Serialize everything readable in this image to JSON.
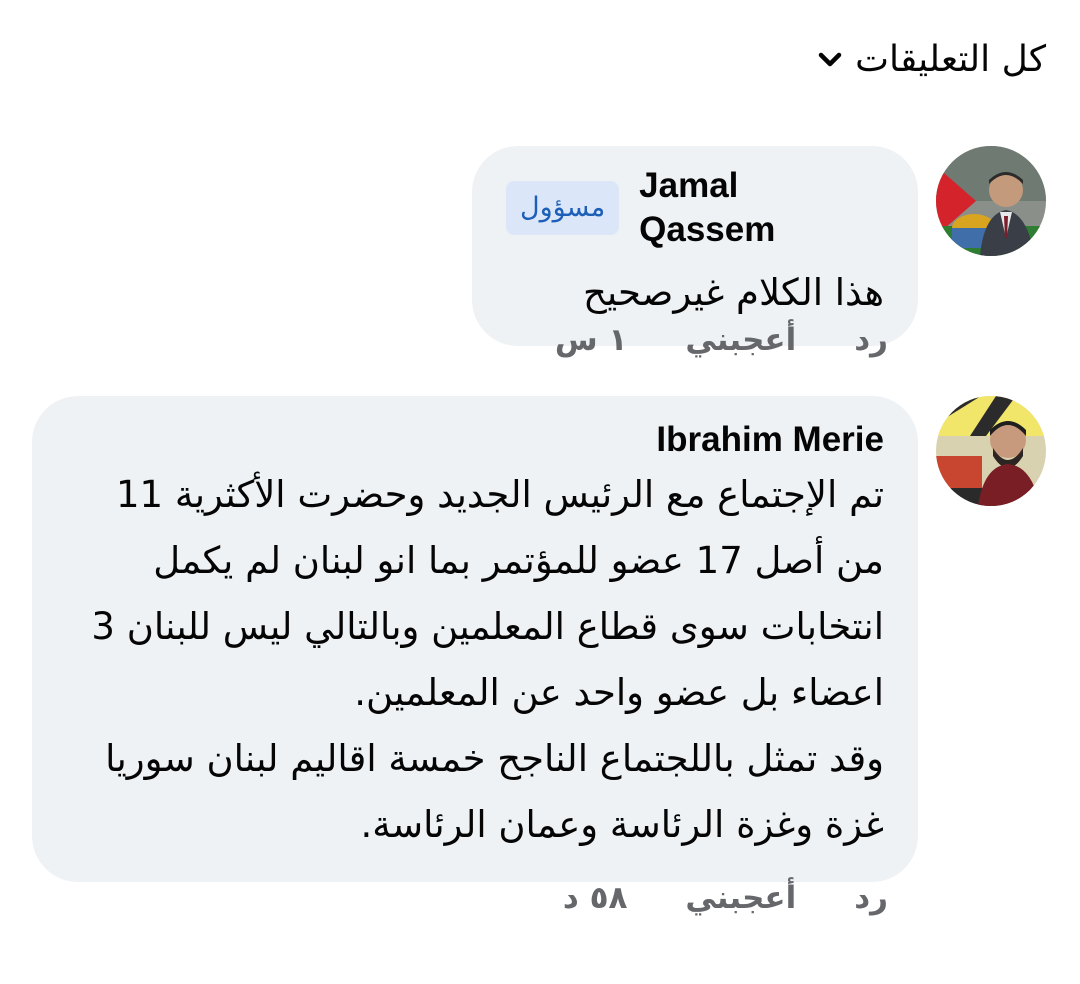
{
  "filter": {
    "label": "كل التعليقات",
    "icon": "chevron-down-icon"
  },
  "comments": [
    {
      "author": "Jamal Qassem",
      "badge": "مسؤول",
      "text": "هذا الكلام غيرصحيح",
      "time": "١ س",
      "like_label": "أعجبني",
      "reply_label": "رد"
    },
    {
      "author": "Ibrahim Merie",
      "text": "تم الإجتماع مع الرئيس الجديد وحضرت الأكثرية 11\nمن أصل 17 عضو للمؤتمر بما انو لبنان لم يكمل\nانتخابات سوى قطاع المعلمين وبالتالي ليس للبنان 3\nاعضاء بل عضو واحد عن المعلمين.\nوقد تمثل باللجتماع الناجح خمسة اقاليم لبنان سوريا\nغزة وغزة الرئاسة وعمان الرئاسة.",
      "time": "٥٨ د",
      "like_label": "أعجبني",
      "reply_label": "رد"
    }
  ],
  "colors": {
    "bubble": "#eff2f5",
    "badge_bg": "#dbe7f8",
    "badge_text": "#1d5fb8",
    "meta_text": "#65676b"
  }
}
